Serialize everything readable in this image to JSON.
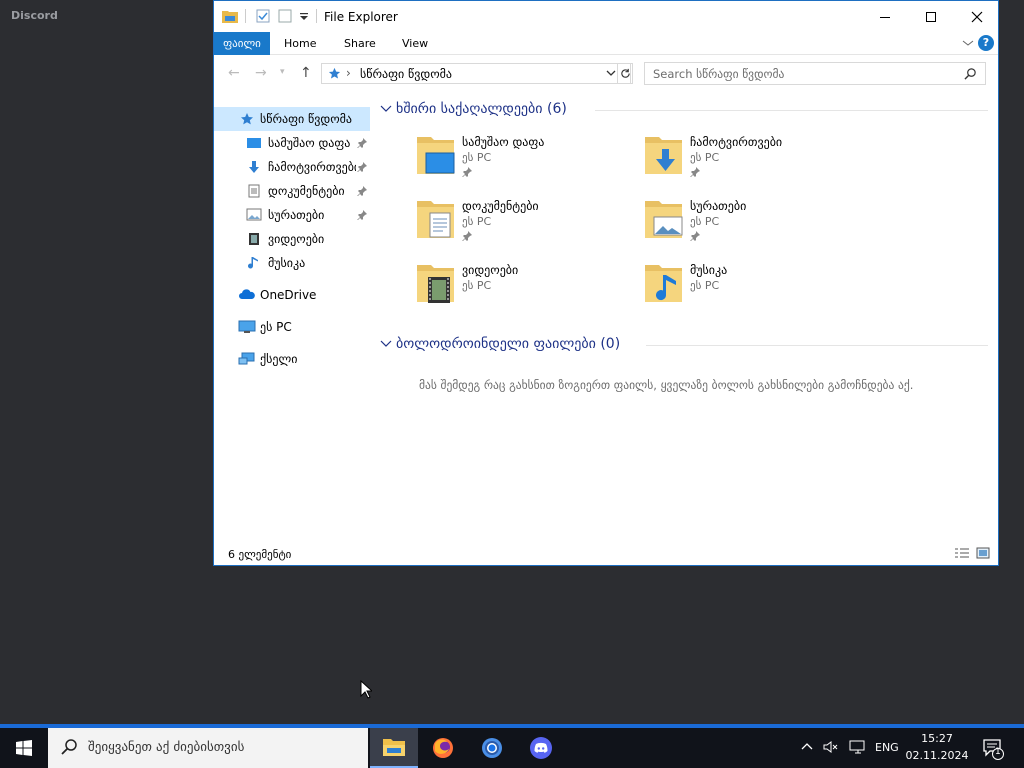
{
  "background_app": {
    "name": "Discord"
  },
  "window": {
    "title": "File Explorer",
    "controls": {
      "minimize": "minimize-icon",
      "maximize": "maximize-icon",
      "close": "close-icon"
    }
  },
  "ribbon": {
    "tabs": [
      {
        "label": "ფაილი",
        "active": true
      },
      {
        "label": "Home"
      },
      {
        "label": "Share"
      },
      {
        "label": "View"
      }
    ],
    "help": "?"
  },
  "address": {
    "path": "სწრაფი წვდომა",
    "search_placeholder": "Search სწრაფი წვდომა"
  },
  "nav_pane": {
    "items": [
      {
        "label": "სწრაფი წვდომა",
        "icon": "star-icon",
        "selected": true
      },
      {
        "label": "სამუშაო დაფა",
        "icon": "desktop-icon",
        "pinned": true
      },
      {
        "label": "ჩამოტვირთვები",
        "icon": "download-icon",
        "pinned": true
      },
      {
        "label": "დოკუმენტები",
        "icon": "document-icon",
        "pinned": true
      },
      {
        "label": "სურათები",
        "icon": "pictures-icon",
        "pinned": true
      },
      {
        "label": "ვიდეოები",
        "icon": "video-icon"
      },
      {
        "label": "მუსიკა",
        "icon": "music-icon"
      },
      {
        "label": "OneDrive",
        "icon": "cloud-icon"
      },
      {
        "label": "ეს PC",
        "icon": "computer-icon"
      },
      {
        "label": "ქსელი",
        "icon": "network-icon"
      }
    ]
  },
  "content": {
    "frequent_header": "ხშირი საქაღალდეები (6)",
    "recent_header": "ბოლოდროინდელი ფაილები (0)",
    "empty_message": "მას შემდეგ რაც გახსნით ზოგიერთ ფაილს, ყველაზე ბოლოს გახსნილები გამოჩნდება აქ.",
    "folders": [
      {
        "name": "სამუშაო დაფა",
        "location": "ეს PC",
        "pinned": true,
        "icon": "desktop-folder-icon"
      },
      {
        "name": "ჩამოტვირთვები",
        "location": "ეს PC",
        "pinned": true,
        "icon": "downloads-folder-icon"
      },
      {
        "name": "დოკუმენტები",
        "location": "ეს PC",
        "pinned": true,
        "icon": "documents-folder-icon"
      },
      {
        "name": "სურათები",
        "location": "ეს PC",
        "pinned": true,
        "icon": "pictures-folder-icon"
      },
      {
        "name": "ვიდეოები",
        "location": "ეს PC",
        "pinned": false,
        "icon": "videos-folder-icon"
      },
      {
        "name": "მუსიკა",
        "location": "ეს PC",
        "pinned": false,
        "icon": "music-folder-icon"
      }
    ]
  },
  "status": {
    "count": "6 ელემენტი"
  },
  "taskbar": {
    "search_placeholder": "შეიყვანეთ აქ ძიებისთვის",
    "apps": [
      "file-explorer-icon",
      "firefox-icon",
      "chrome-icon",
      "discord-icon"
    ],
    "language": "ENG",
    "time": "15:27",
    "date": "02.11.2024",
    "notification_count": "1"
  },
  "colors": {
    "accent": "#1979ca",
    "taskbar": "#10131a",
    "discord_bg": "#2c2d31"
  }
}
